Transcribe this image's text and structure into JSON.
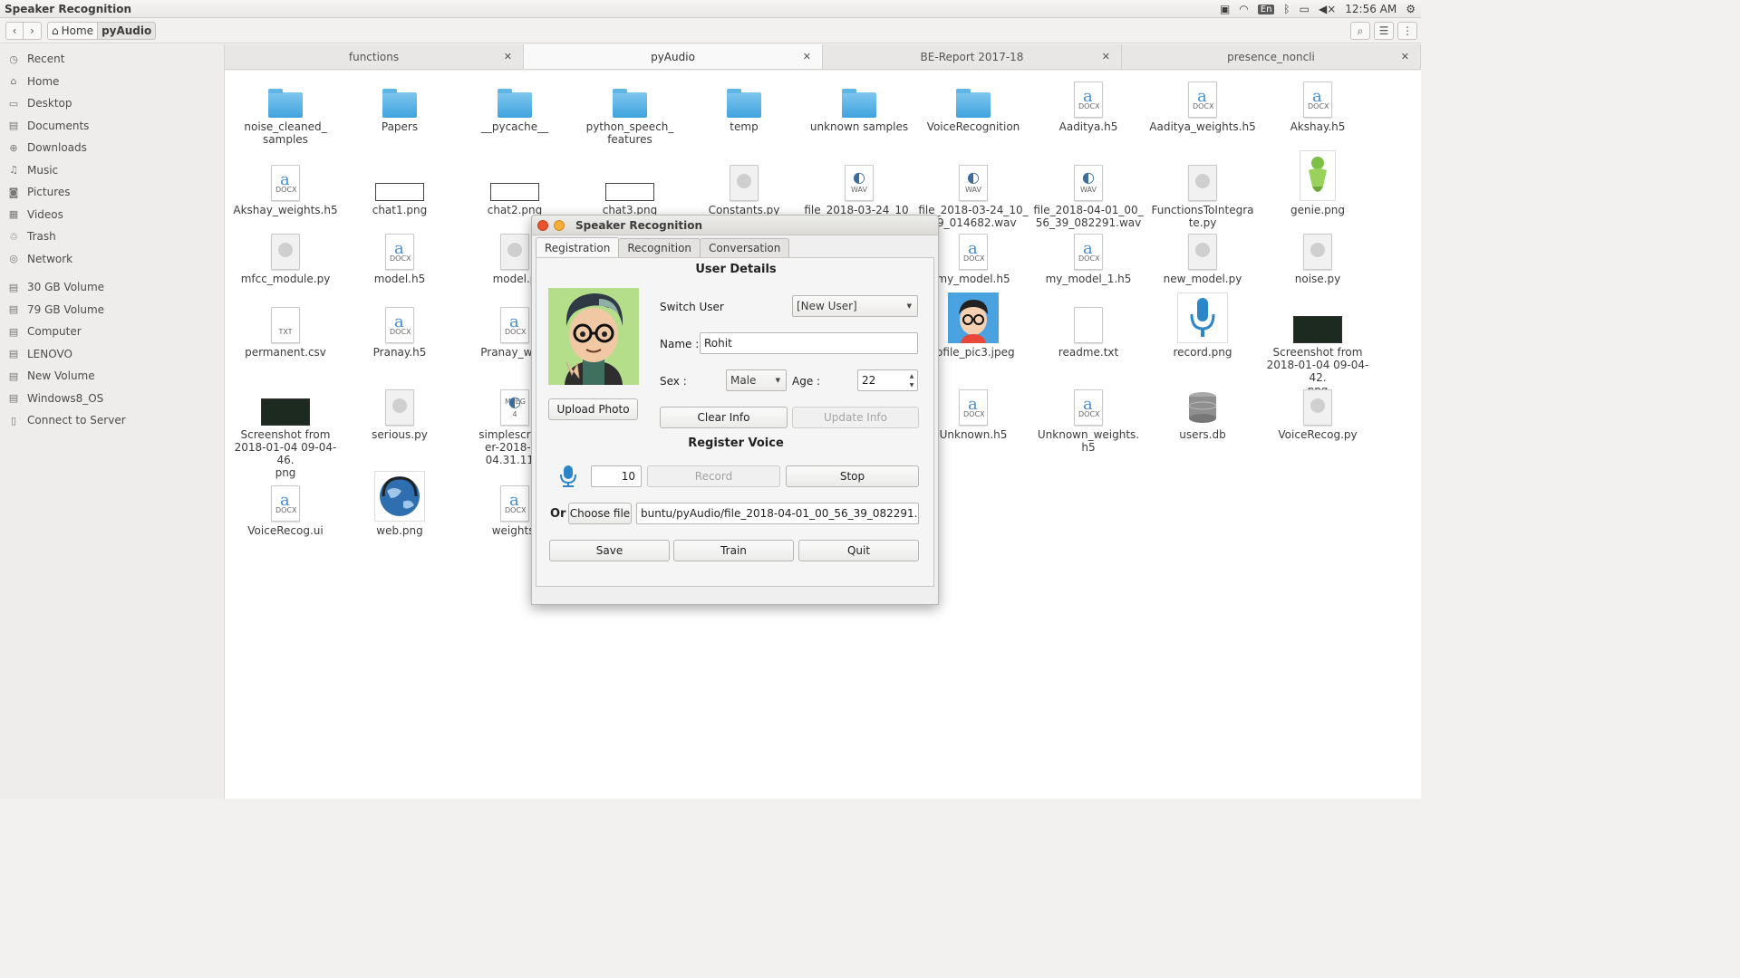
{
  "topbar": {
    "app_title": "Speaker Recognition",
    "lang": "En",
    "clock": "12:56 AM"
  },
  "toolbar": {
    "back": "‹",
    "forward": "›",
    "crumb_home": "Home",
    "crumb_current": "pyAudio"
  },
  "sidebar": {
    "items": [
      {
        "label": "Recent",
        "icon": "clock-icon"
      },
      {
        "label": "Home",
        "icon": "home-icon"
      },
      {
        "label": "Desktop",
        "icon": "desktop-icon"
      },
      {
        "label": "Documents",
        "icon": "documents-icon"
      },
      {
        "label": "Downloads",
        "icon": "downloads-icon"
      },
      {
        "label": "Music",
        "icon": "music-icon"
      },
      {
        "label": "Pictures",
        "icon": "pictures-icon"
      },
      {
        "label": "Videos",
        "icon": "videos-icon"
      },
      {
        "label": "Trash",
        "icon": "trash-icon"
      },
      {
        "label": "Network",
        "icon": "network-icon"
      }
    ],
    "devices": [
      {
        "label": "30 GB Volume"
      },
      {
        "label": "79 GB Volume"
      },
      {
        "label": "Computer"
      },
      {
        "label": "LENOVO"
      },
      {
        "label": "New Volume"
      },
      {
        "label": "Windows8_OS"
      },
      {
        "label": "Connect to Server"
      }
    ]
  },
  "tabs": [
    {
      "label": "functions"
    },
    {
      "label": "pyAudio"
    },
    {
      "label": "BE-Report 2017-18"
    },
    {
      "label": "presence_noncli"
    }
  ],
  "files": {
    "r1": [
      "noise_cleaned_\nsamples",
      "Papers",
      "__pycache__",
      "python_speech_\nfeatures",
      "temp",
      "unknown samples",
      "VoiceRecognition",
      "Aaditya.h5",
      "Aaditya_weights.h5",
      "Akshay.h5"
    ],
    "r2": [
      "Akshay_weights.h5",
      "chat1.png",
      "chat2.png",
      "chat3.png",
      "Constants.py",
      "file_2018-03-24_10_\n05_30_790997",
      "file_2018-03-24_10_\n49_014682.wav",
      "file_2018-04-01_00_\n56_39_082291.wav",
      "FunctionsToIntegra\nte.py",
      "genie.png"
    ],
    "r3": [
      "mfcc_module.py",
      "model.h5",
      "model.p",
      "my_model.h5",
      "my_model_1.h5",
      "new_model.py",
      "noise.py"
    ],
    "r4": [
      "permanent.csv",
      "Pranay.h5",
      "Pranay_weig",
      "rofile_pic3.jpeg",
      "readme.txt",
      "record.png",
      "Screenshot from\n2018-01-04 09-04-42.\npng"
    ],
    "r5": [
      "Screenshot from\n2018-01-04 09-04-46.\npng",
      "serious.py",
      "simplescreen\ner-2018-03\n04.31.11.n",
      "Unknown.h5",
      "Unknown_weights.\nh5",
      "users.db",
      "VoiceRecog.py"
    ],
    "r6": [
      "VoiceRecog.ui",
      "web.png",
      "weights."
    ],
    "badges": {
      "docx": "DOCX",
      "wav": "WAV",
      "txt": "TXT",
      "mpeg": "MPEG 4"
    }
  },
  "dialog": {
    "title": "Speaker Recognition",
    "tabs": [
      "Registration",
      "Recognition",
      "Conversation"
    ],
    "user_details_heading": "User Details",
    "switch_user_label": "Switch User",
    "switch_user_value": "[New User]",
    "name_label": "Name :",
    "name_value": "Rohit",
    "sex_label": "Sex :",
    "sex_value": "Male",
    "age_label": "Age :",
    "age_value": "22",
    "upload_photo": "Upload Photo",
    "clear_info": "Clear Info",
    "update_info": "Update Info",
    "register_voice_heading": "Register Voice",
    "duration_value": "10",
    "record": "Record",
    "stop": "Stop",
    "or_label": "Or",
    "choose_file": "Choose file",
    "file_path": "buntu/pyAudio/file_2018-04-01_00_56_39_082291.wav",
    "save": "Save",
    "train": "Train",
    "quit": "Quit"
  },
  "colors": {
    "folder": "#3fa3dd",
    "mic": "#2b86c9",
    "close": "#e9542d",
    "minimize": "#f4ad3a"
  }
}
